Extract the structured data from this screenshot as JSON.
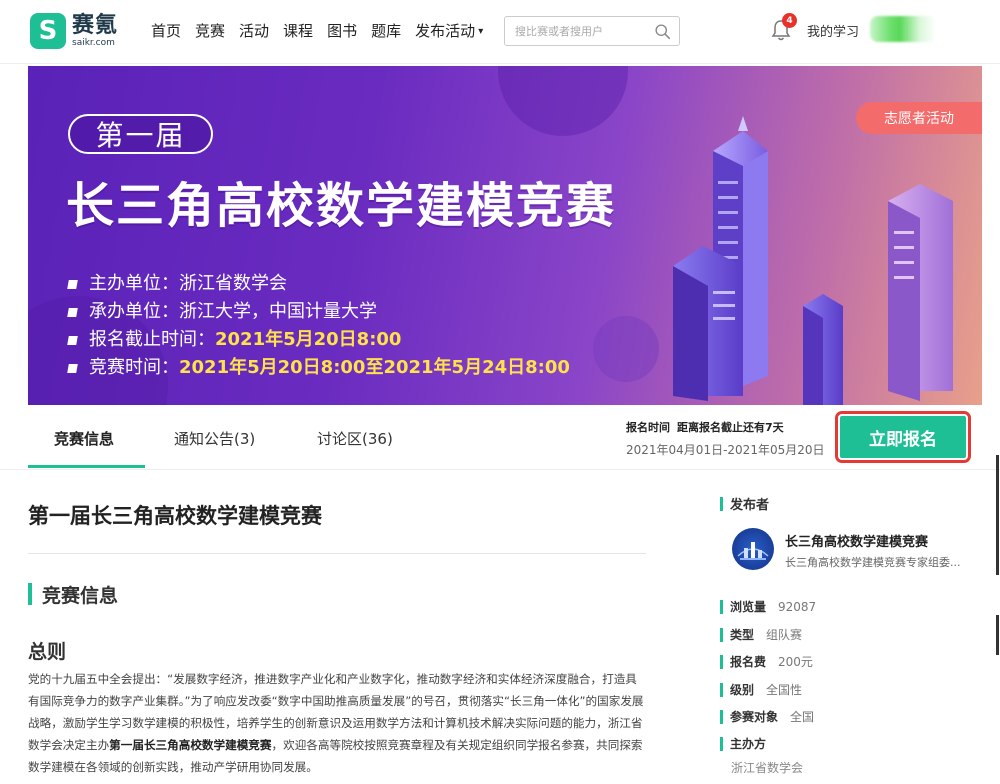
{
  "header": {
    "logo": {
      "cn": "赛氪",
      "en": "saikr.com",
      "mark": "S"
    },
    "nav": [
      "首页",
      "竞赛",
      "活动",
      "课程",
      "图书",
      "题库",
      "发布活动"
    ],
    "search_placeholder": "搜比赛或者搜用户",
    "notification_count": "4",
    "my_study": "我的学习"
  },
  "banner": {
    "edition": "第一届",
    "title": "长三角高校数学建模竞赛",
    "organizer": "主办单位：浙江省数学会",
    "co_organizer": "承办单位：浙江大学，中国计量大学",
    "deadline_label": "报名截止时间：",
    "deadline_value": "2021年5月20日8:00",
    "contest_time_label": "竞赛时间：",
    "contest_time_value": "2021年5月20日8:00至2021年5月24日8:00",
    "volunteer_tag": "志愿者活动"
  },
  "tabs": [
    "竞赛信息",
    "通知公告(3)",
    "讨论区(36)"
  ],
  "registration": {
    "label": "报名时间",
    "countdown": "距离报名截止还有7天",
    "range": "2021年04月01日-2021年05月20日",
    "button": "立即报名"
  },
  "main": {
    "title": "第一届长三角高校数学建模竞赛",
    "section": "竞赛信息",
    "subhead": "总则",
    "para_1": "党的十九届五中全会提出：“发展数字经济，推进数字产业化和产业数字化，推动数字经济和实体经济深度融合，打造具有国际竞争力的数字产业集群。”为了响应发改委“数字中国助推高质量发展”的号召，贯彻落实“长三角一体化”的国家发展战略，激励学生学习数学建模的积极性，培养学生的创新意识及运用数学方法和计算机技术解决实际问题的能力，浙江省数学会决定主办",
    "para_bold": "第一届长三角高校数学建模竞赛",
    "para_2": "，欢迎各高等院校按照竞赛章程及有关规定组织同学报名参赛，共同探索数学建模在各领域的创新实践，推动产学研用协同发展。"
  },
  "sidebar": {
    "publisher_label": "发布者",
    "publisher_name": "长三角高校数学建模竞赛",
    "publisher_desc": "长三角高校数学建模竞赛专家组委...",
    "views_label": "浏览量",
    "views": "92087",
    "type_label": "类型",
    "type": "组队赛",
    "fee_label": "报名费",
    "fee": "200元",
    "level_label": "级别",
    "level": "全国性",
    "audience_label": "参赛对象",
    "audience": "全国",
    "host_label": "主办方",
    "host": "浙江省数学会"
  }
}
